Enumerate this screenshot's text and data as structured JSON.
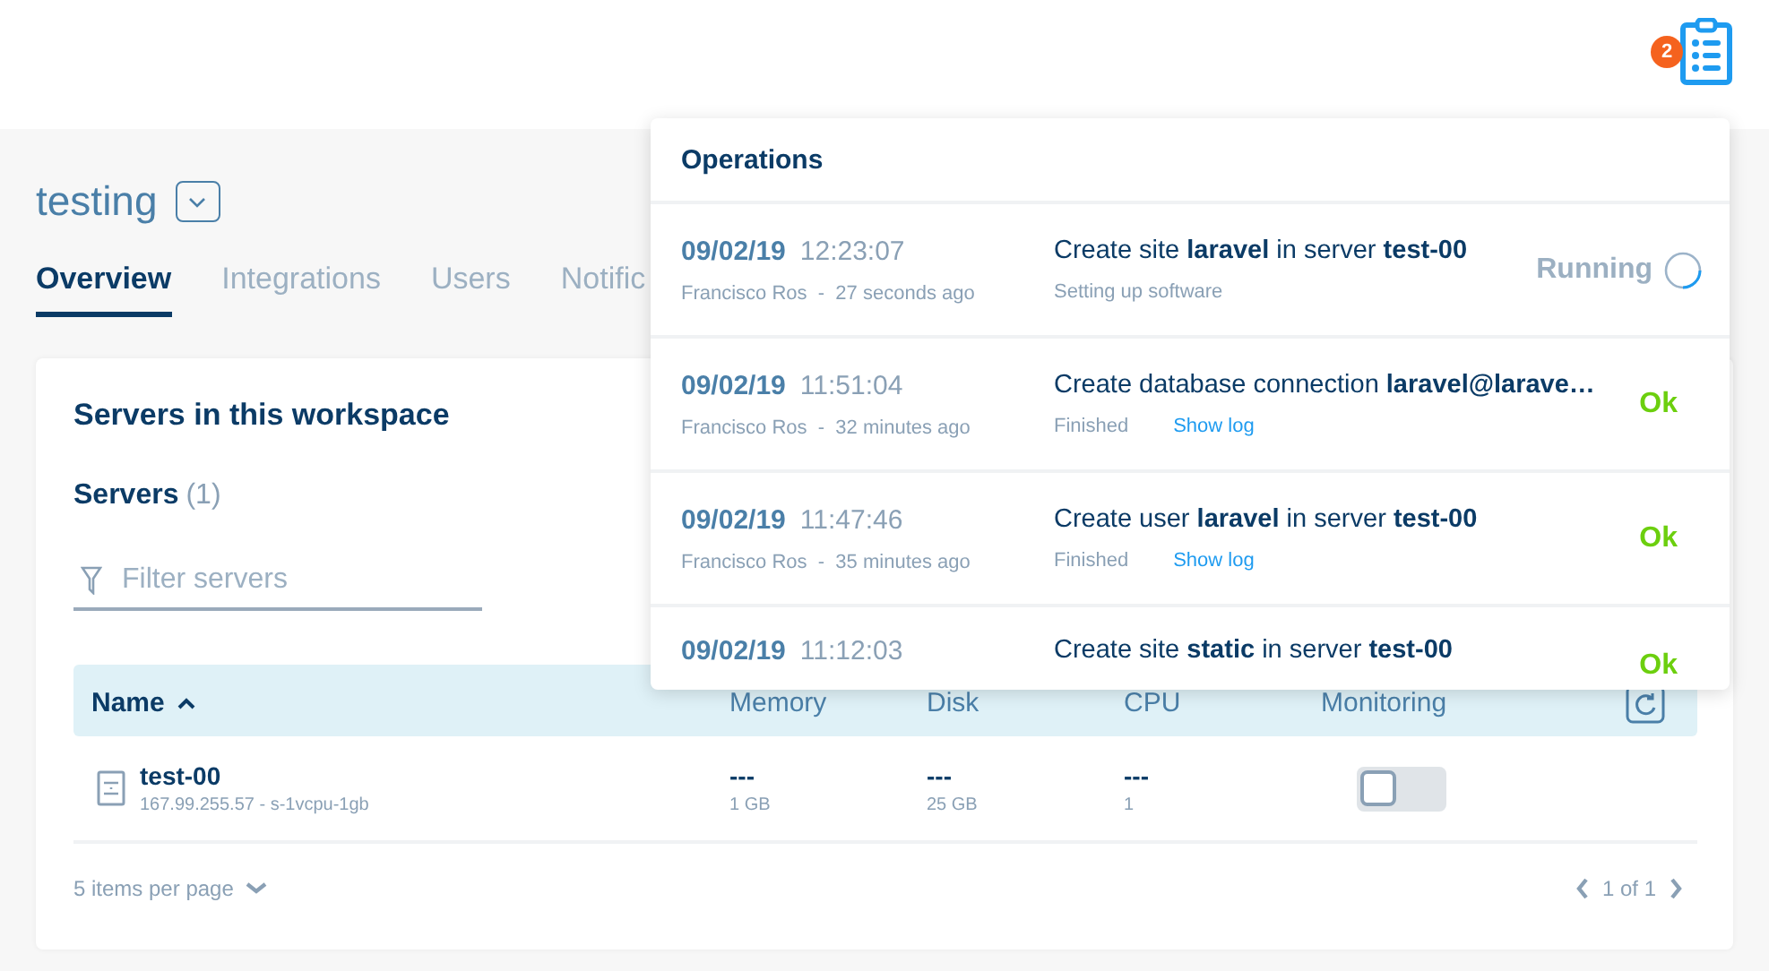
{
  "header": {
    "badge": "2"
  },
  "workspace": {
    "title": "testing"
  },
  "tabs": [
    {
      "label": "Overview",
      "selected": true
    },
    {
      "label": "Integrations",
      "selected": false
    },
    {
      "label": "Users",
      "selected": false
    },
    {
      "label": "Notific",
      "selected": false
    }
  ],
  "card": {
    "title": "Servers in this workspace",
    "section": "Servers",
    "count": "(1)",
    "filter": {
      "placeholder": "Filter servers"
    },
    "table": {
      "columns": [
        "Name",
        "Memory",
        "Disk",
        "CPU",
        "Monitoring"
      ],
      "rows": [
        {
          "name": "test-00",
          "detail": "167.99.255.57 - s-1vcpu-1gb",
          "memory": "---",
          "memory_total": "1 GB",
          "disk": "---",
          "disk_total": "25 GB",
          "cpu": "---",
          "cpu_total": "1",
          "monitoring": false
        }
      ]
    },
    "per_page": "5 items per page",
    "pages": "1 of 1"
  },
  "operations": {
    "title": "Operations",
    "items": [
      {
        "date": "09/02/19",
        "time": "12:23:07",
        "meta": "Francisco Ros  -  27 seconds ago",
        "message": "Create site **laravel** in server **test-00**",
        "note": "Setting up software",
        "status": "Running",
        "kind": "running"
      },
      {
        "date": "09/02/19",
        "time": "11:51:04",
        "meta": "Francisco Ros  -  32 minutes ago",
        "message": "Create database connection **laravel@larave…**",
        "note": "Finished",
        "link": "Show log",
        "status": "Ok",
        "kind": "ok"
      },
      {
        "date": "09/02/19",
        "time": "11:47:46",
        "meta": "Francisco Ros  -  35 minutes ago",
        "message": "Create user **laravel** in server **test-00**",
        "note": "Finished",
        "link": "Show log",
        "status": "Ok",
        "kind": "ok"
      },
      {
        "date": "09/02/19",
        "time": "11:12:03",
        "message": "Create site **static** in server **test-00**",
        "status": "Ok",
        "kind": "ok"
      }
    ]
  }
}
